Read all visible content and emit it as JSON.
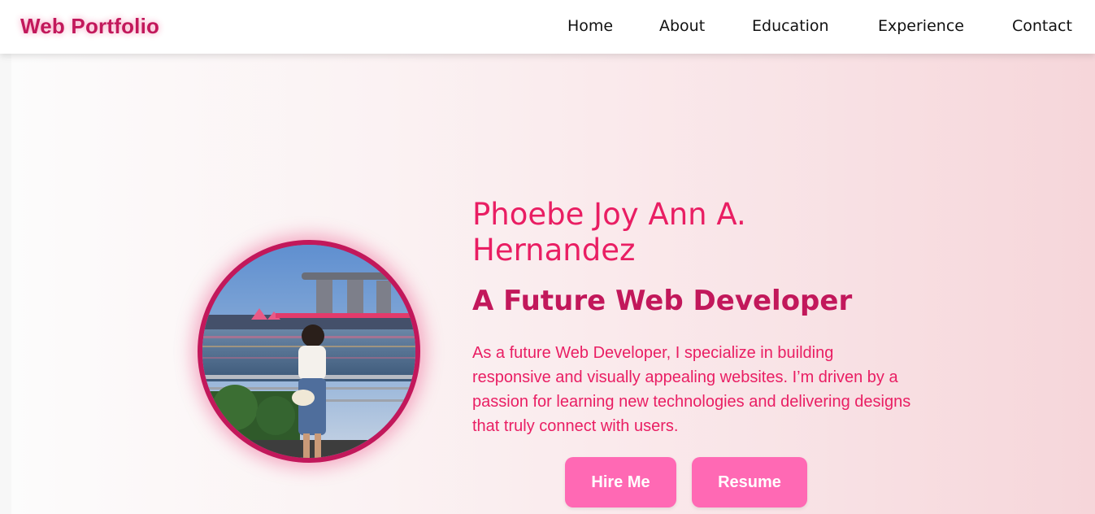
{
  "header": {
    "logo": "Web Portfolio",
    "nav": [
      {
        "label": "Home"
      },
      {
        "label": "About"
      },
      {
        "label": "Education"
      },
      {
        "label": "Experience"
      },
      {
        "label": "Contact"
      }
    ]
  },
  "hero": {
    "name": "Phoebe Joy Ann A. Hernandez",
    "tagline": "A Future Web Developer",
    "intro": "As a future Web Developer, I specialize in building responsive and visually appealing websites. I’m driven by a passion for learning new technologies and delivering designs that truly connect with users.",
    "buttons": {
      "hire": "Hire Me",
      "resume": "Resume"
    }
  },
  "colors": {
    "brand": "#c2185b",
    "accent": "#e91e63",
    "button": "#ff69b4"
  }
}
